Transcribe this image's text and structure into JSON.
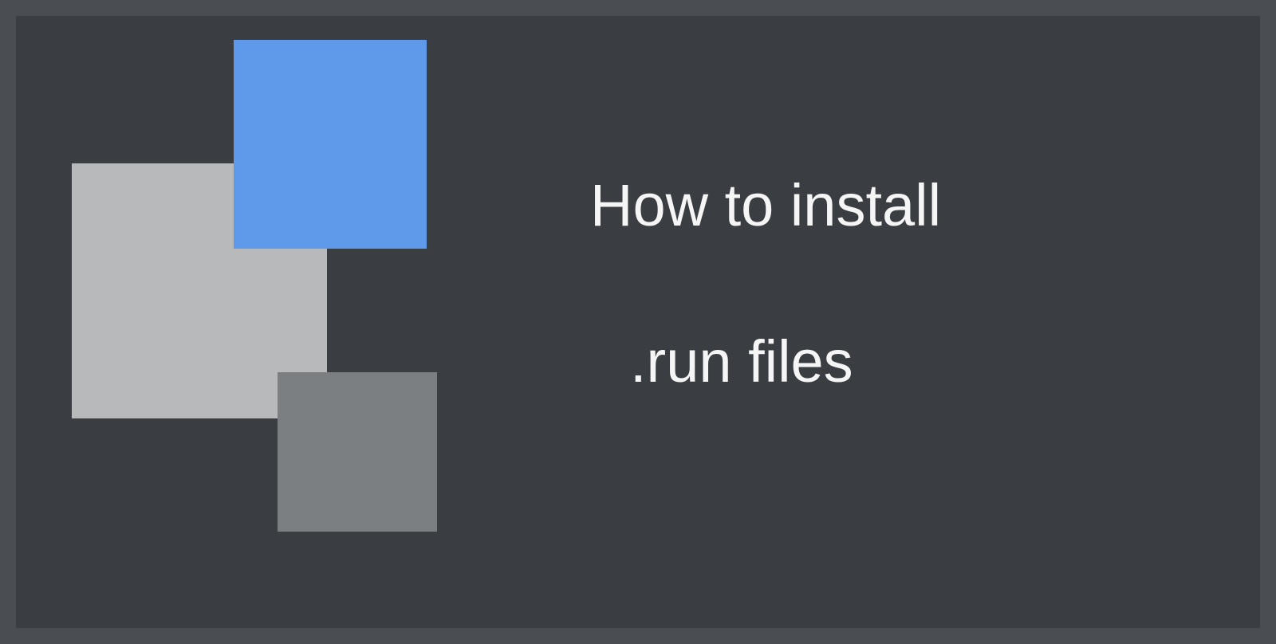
{
  "title": {
    "line1": "How to install",
    "line2": ".run files"
  },
  "graphic": {
    "squares": [
      {
        "name": "light-gray-square",
        "color": "#b8b9bb"
      },
      {
        "name": "blue-square",
        "color": "#5e99ea"
      },
      {
        "name": "dark-gray-square",
        "color": "#7c7f82"
      }
    ]
  }
}
